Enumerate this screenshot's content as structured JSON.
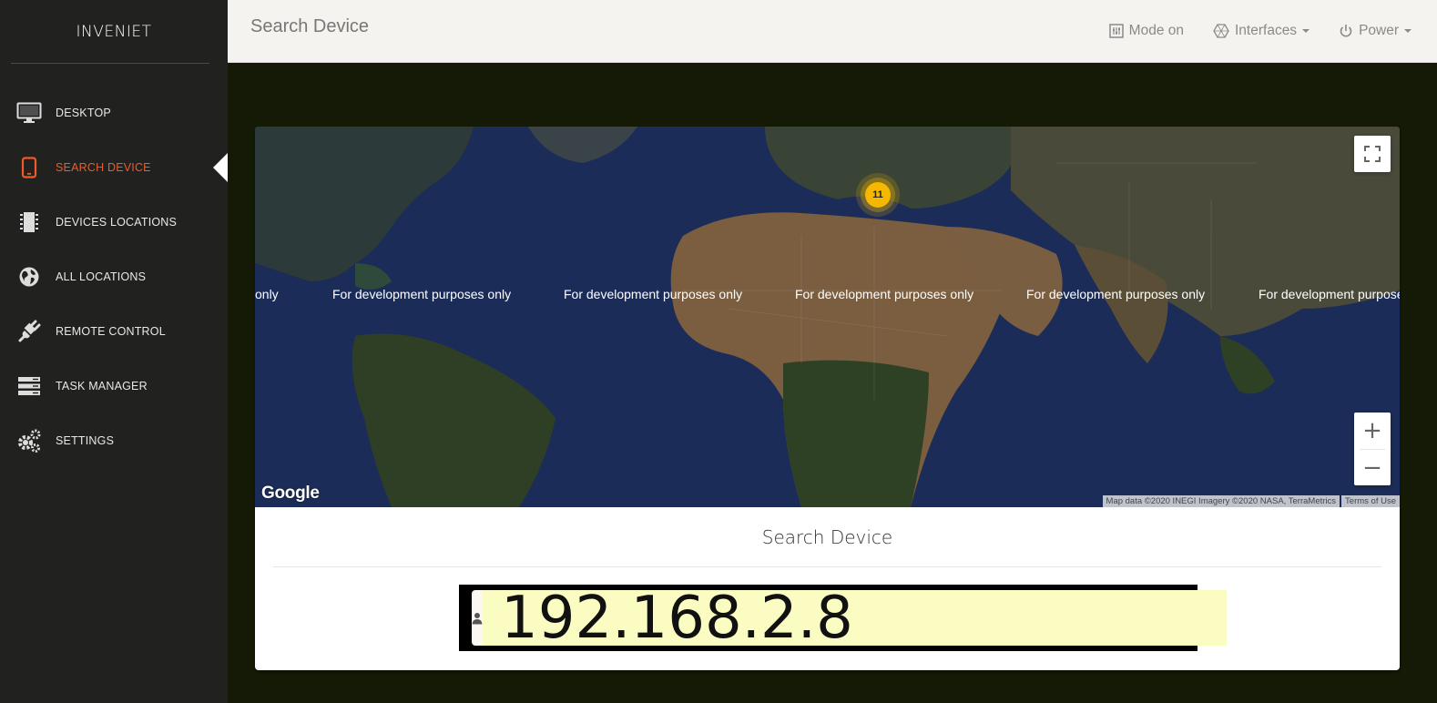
{
  "app": {
    "brand": "INVENIET"
  },
  "sidebar": {
    "items": [
      {
        "label": "DESKTOP",
        "icon": "monitor-icon"
      },
      {
        "label": "SEARCH DEVICE",
        "icon": "tablet-icon",
        "active": true
      },
      {
        "label": "DEVICES LOCATIONS",
        "icon": "chip-icon"
      },
      {
        "label": "ALL LOCATIONS",
        "icon": "globe-icon"
      },
      {
        "label": "REMOTE CONTROL",
        "icon": "plug-icon"
      },
      {
        "label": "TASK MANAGER",
        "icon": "server-icon"
      },
      {
        "label": "SETTINGS",
        "icon": "gears-icon"
      }
    ]
  },
  "header": {
    "title": "Search Device",
    "actions": {
      "mode": "Mode on",
      "interfaces": "Interfaces",
      "power": "Power"
    }
  },
  "map": {
    "watermark": "For development purposes only",
    "watermark_partial_left": "only",
    "watermark_partial_right": "For development purpose",
    "cluster_count": "11",
    "google": "Google",
    "attribution": "Map data ©2020 INEGI Imagery ©2020 NASA, TerraMetrics",
    "terms": "Terms of Use",
    "colors": {
      "ocean": "#1b2b55",
      "land_desert": "#8a6b4a",
      "land_green": "#2f3f22",
      "cluster": "#f5b800"
    }
  },
  "search": {
    "title": "Search Device",
    "value": "192.168.2.8"
  },
  "colors": {
    "accent": "#f05a28",
    "sidebar_bg": "#212120",
    "page_bg": "#141a05"
  }
}
